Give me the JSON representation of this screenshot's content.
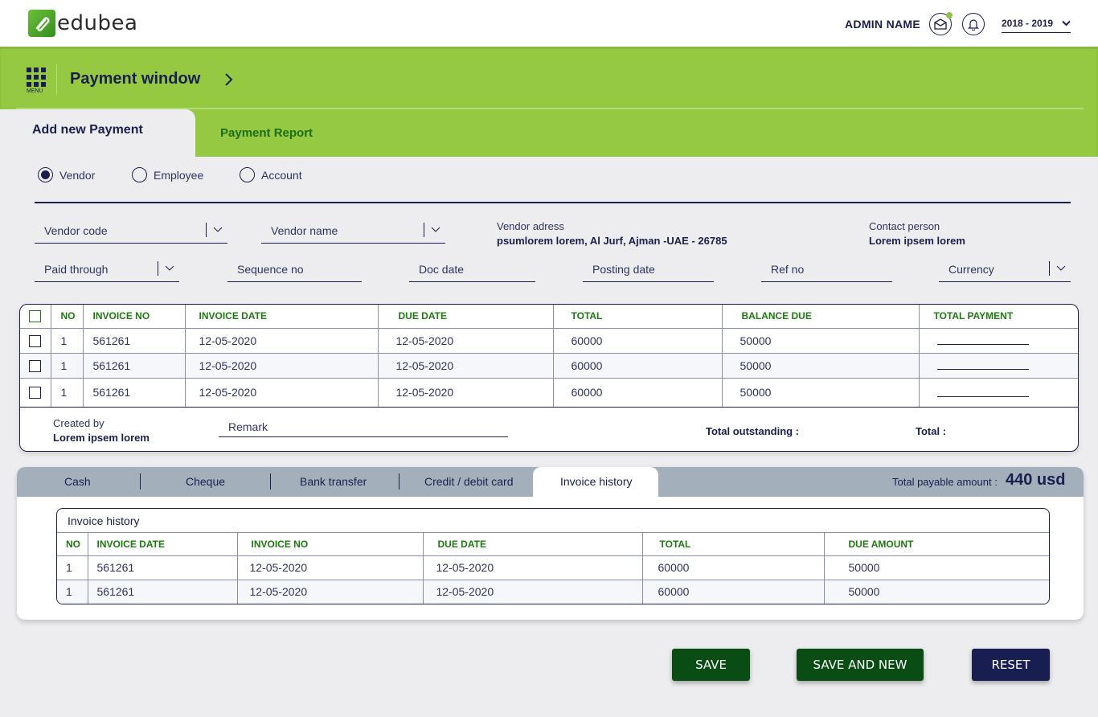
{
  "header": {
    "logo_text": "edubea",
    "admin_name": "ADMIN NAME",
    "year": "2018 - 2019",
    "menu_label": "MENU",
    "page_title": "Payment window"
  },
  "tabs": {
    "active": "Add new Payment",
    "other": "Payment Report"
  },
  "radios": [
    {
      "label": "Vendor",
      "checked": true
    },
    {
      "label": "Employee",
      "checked": false
    },
    {
      "label": "Account",
      "checked": false
    }
  ],
  "form": {
    "vendor_code": "Vendor code",
    "vendor_name": "Vendor name",
    "vendor_address_label": "Vendor adress",
    "vendor_address_value": "psumlorem lorem, Al Jurf, Ajman -UAE - 26785",
    "contact_person_label": "Contact person",
    "contact_person_value": "Lorem ipsem lorem",
    "paid_through": "Paid through",
    "sequence_no": "Sequence no",
    "doc_date": "Doc date",
    "posting_date": "Posting date",
    "ref_no": "Ref no",
    "currency": "Currency"
  },
  "invoice_table": {
    "headers": [
      "NO",
      "INVOICE NO",
      "INVOICE DATE",
      "DUE DATE",
      "TOTAL",
      "BALANCE DUE",
      "TOTAL PAYMENT"
    ],
    "rows": [
      {
        "no": "1",
        "invoice_no": "561261",
        "invoice_date": "12-05-2020",
        "due_date": "12-05-2020",
        "total": "60000",
        "balance_due": "50000",
        "total_payment": ""
      },
      {
        "no": "1",
        "invoice_no": "561261",
        "invoice_date": "12-05-2020",
        "due_date": "12-05-2020",
        "total": "60000",
        "balance_due": "50000",
        "total_payment": ""
      },
      {
        "no": "1",
        "invoice_no": "561261",
        "invoice_date": "12-05-2020",
        "due_date": "12-05-2020",
        "total": "60000",
        "balance_due": "50000",
        "total_payment": ""
      }
    ],
    "footer": {
      "created_by_label": "Created by",
      "created_by_value": "Lorem ipsem lorem",
      "remark_placeholder": "Remark",
      "total_outstanding_label": "Total outstanding :",
      "total_label": "Total :"
    }
  },
  "payment_tabs": {
    "items": [
      "Cash",
      "Cheque",
      "Bank transfer",
      "Credit / debit card",
      "Invoice history"
    ],
    "active": "Invoice history",
    "total_payable_label": "Total payable amount :",
    "total_payable_value": "440 usd"
  },
  "invoice_history": {
    "title": "Invoice history",
    "headers": [
      "NO",
      "INVOICE DATE",
      "INVOICE NO",
      "DUE DATE",
      "TOTAL",
      "DUE AMOUNT"
    ],
    "rows": [
      {
        "no": "1",
        "invoice_date": "561261",
        "invoice_no": "12-05-2020",
        "due_date": "12-05-2020",
        "total": "60000",
        "due_amount": "50000"
      },
      {
        "no": "1",
        "invoice_date": "561261",
        "invoice_no": "12-05-2020",
        "due_date": "12-05-2020",
        "total": "60000",
        "due_amount": "50000"
      }
    ]
  },
  "buttons": {
    "save": "SAVE",
    "save_and_new": "SAVE AND NEW",
    "reset": "RESET"
  },
  "colors": {
    "brand_green": "#95c942",
    "dark_green": "#0a4d14",
    "navy": "#181d52",
    "header_green_text": "#1d7a10"
  }
}
